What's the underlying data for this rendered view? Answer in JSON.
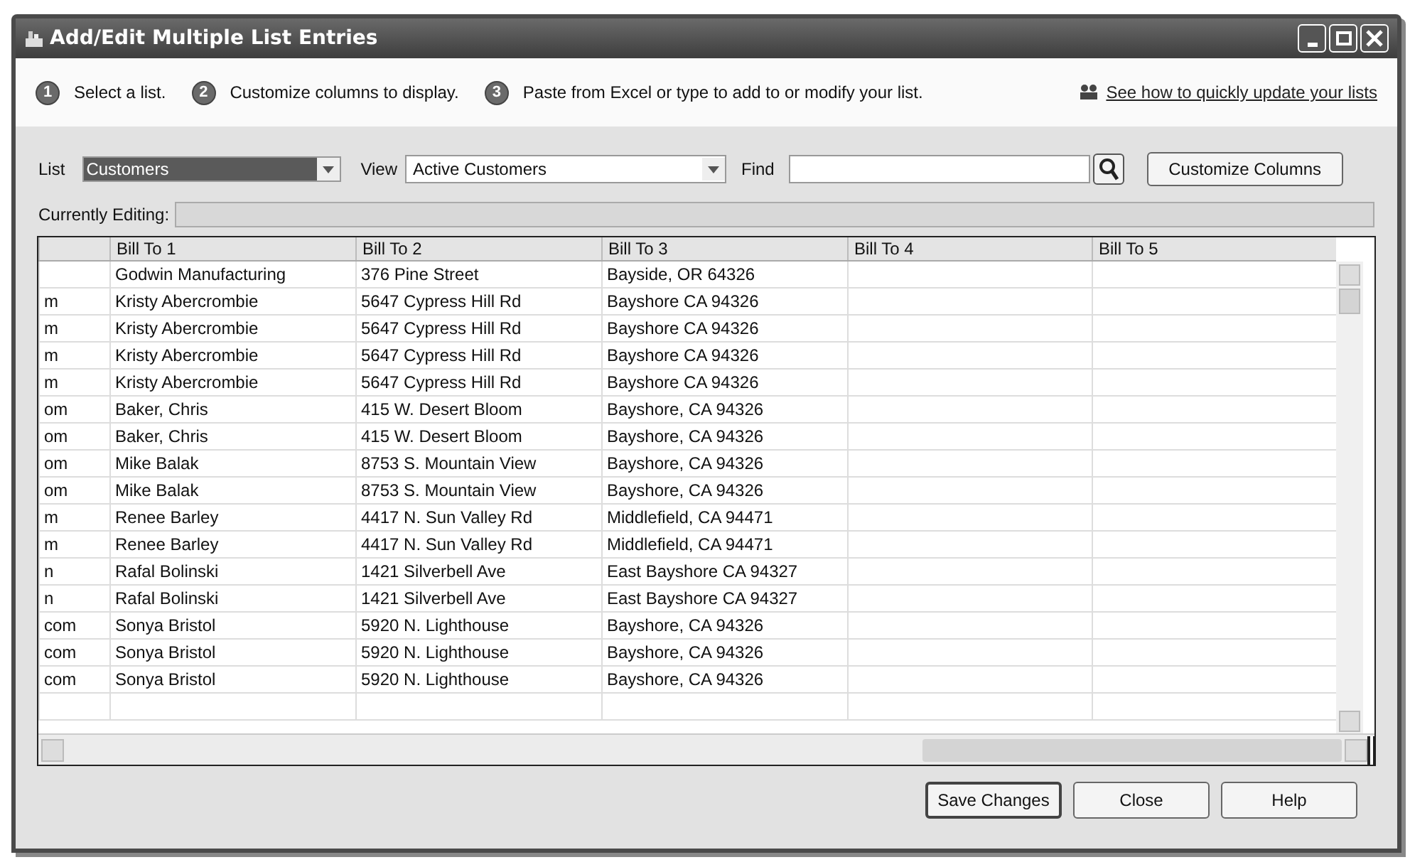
{
  "window": {
    "title": "Add/Edit Multiple List Entries"
  },
  "steps": [
    {
      "number": "1",
      "label": "Select a list."
    },
    {
      "number": "2",
      "label": "Customize columns to display."
    },
    {
      "number": "3",
      "label": "Paste from Excel or type to add to or modify your list."
    }
  ],
  "help_link": "See how to quickly update your lists",
  "list": {
    "label": "List",
    "value": "Customers"
  },
  "view": {
    "label": "View",
    "value": "Active Customers"
  },
  "find": {
    "label": "Find"
  },
  "customize_button": "Customize Columns",
  "currently_editing": {
    "label": "Currently Editing:"
  },
  "table": {
    "columns": [
      "",
      "Bill To 1",
      "Bill To 2",
      "Bill To 3",
      "Bill To 4",
      "Bill To 5"
    ],
    "rows": [
      [
        "",
        "Godwin Manufacturing",
        "376 Pine Street",
        "Bayside, OR 64326",
        "",
        ""
      ],
      [
        "m",
        "Kristy Abercrombie",
        "5647 Cypress Hill Rd",
        "Bayshore CA 94326",
        "",
        ""
      ],
      [
        "m",
        "Kristy Abercrombie",
        "5647 Cypress Hill Rd",
        "Bayshore CA 94326",
        "",
        ""
      ],
      [
        "m",
        "Kristy Abercrombie",
        "5647 Cypress Hill Rd",
        "Bayshore CA 94326",
        "",
        ""
      ],
      [
        "m",
        "Kristy Abercrombie",
        "5647 Cypress Hill Rd",
        "Bayshore CA 94326",
        "",
        ""
      ],
      [
        "om",
        "Baker, Chris",
        "415 W. Desert Bloom",
        "Bayshore, CA  94326",
        "",
        ""
      ],
      [
        "om",
        "Baker, Chris",
        "415 W. Desert Bloom",
        "Bayshore, CA  94326",
        "",
        ""
      ],
      [
        "om",
        "Mike Balak",
        "8753 S. Mountain View",
        "Bayshore, CA  94326",
        "",
        ""
      ],
      [
        "om",
        "Mike Balak",
        "8753 S. Mountain View",
        "Bayshore, CA  94326",
        "",
        ""
      ],
      [
        "m",
        "Renee Barley",
        "4417 N. Sun Valley Rd",
        "Middlefield, CA  94471",
        "",
        ""
      ],
      [
        "m",
        "Renee Barley",
        "4417 N. Sun Valley Rd",
        "Middlefield, CA  94471",
        "",
        ""
      ],
      [
        "n",
        "Rafal Bolinski",
        "1421 Silverbell Ave",
        "East Bayshore CA 94327",
        "",
        ""
      ],
      [
        "n",
        "Rafal Bolinski",
        "1421 Silverbell Ave",
        "East Bayshore CA 94327",
        "",
        ""
      ],
      [
        "com",
        "Sonya Bristol",
        "5920 N. Lighthouse",
        "Bayshore, CA  94326",
        "",
        ""
      ],
      [
        "com",
        "Sonya Bristol",
        "5920 N. Lighthouse",
        "Bayshore, CA  94326",
        "",
        ""
      ],
      [
        "com",
        "Sonya Bristol",
        "5920 N. Lighthouse",
        "Bayshore, CA  94326",
        "",
        ""
      ]
    ]
  },
  "buttons": [
    "Save Changes",
    "Close",
    "Help"
  ]
}
